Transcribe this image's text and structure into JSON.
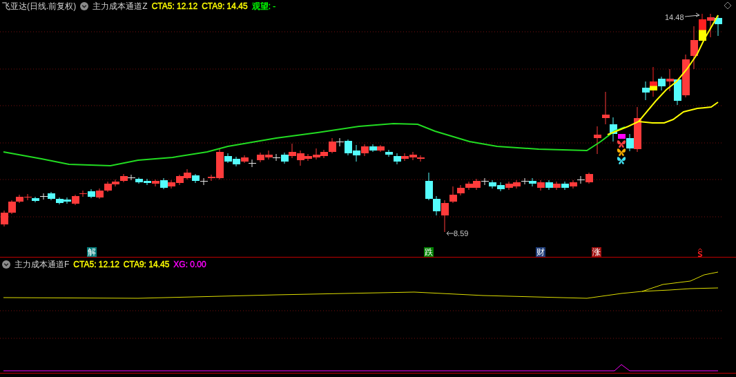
{
  "main_panel": {
    "stock": "飞亚达(日线.前复权)",
    "indicator": "主力成本通道Z",
    "values": [
      {
        "label": "CTA5: 12.12",
        "color": "#ffff00"
      },
      {
        "label": "CTA9: 14.45",
        "color": "#ffff00"
      },
      {
        "label": "观望: -",
        "color": "#00ff00"
      }
    ],
    "price_labels": [
      {
        "text": "14.48"
      },
      {
        "text": "8.59"
      }
    ],
    "markers": [
      {
        "label": "解",
        "color": "#007b7b"
      },
      {
        "label": "跌",
        "color": "#008000"
      },
      {
        "label": "财",
        "color": "#1e3c78"
      },
      {
        "label": "涨",
        "color": "#a01010"
      }
    ]
  },
  "sub_panel": {
    "indicator": "主力成本通道F",
    "values": [
      {
        "label": "CTA5: 12.12",
        "color": "#ffff00"
      },
      {
        "label": "CTA9: 14.45",
        "color": "#ffff00"
      },
      {
        "label": "XG: 0.00",
        "color": "#ff00ff"
      }
    ]
  }
}
